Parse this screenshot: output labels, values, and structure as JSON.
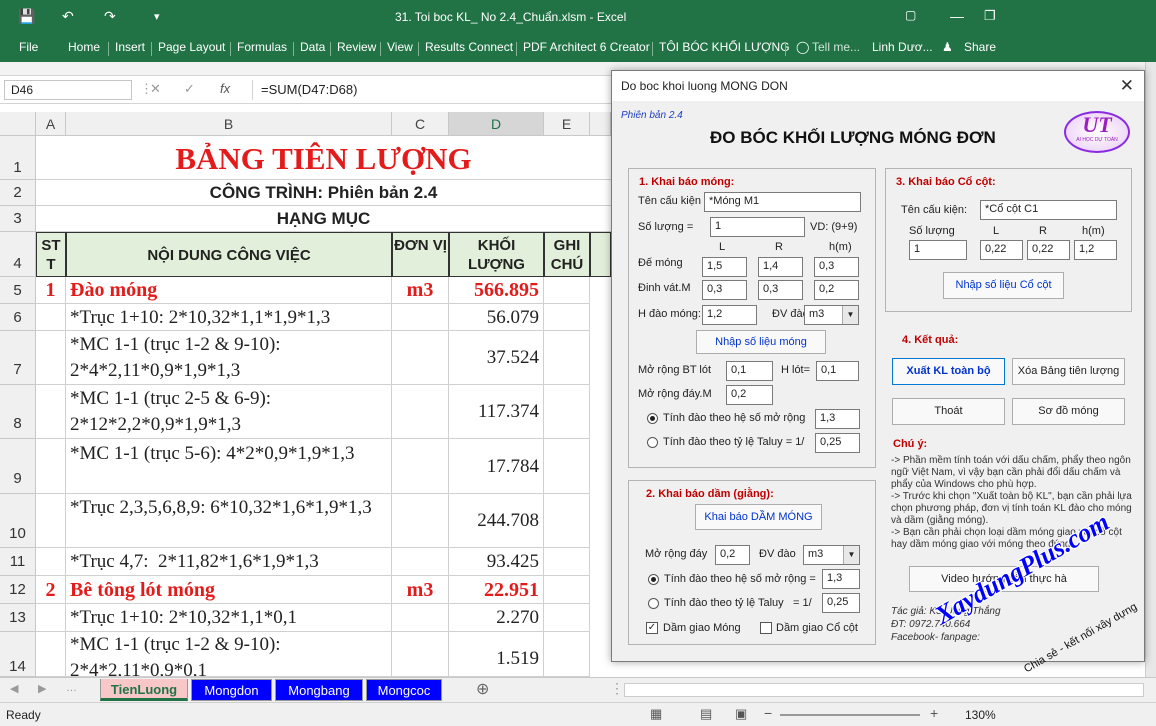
{
  "window": {
    "title": "31. Toi boc KL_ No 2.4_Chuẩn.xlsm - Excel",
    "user": "Linh Dươ...",
    "share": "Share",
    "tell_me": "Tell me..."
  },
  "menu": {
    "file": "File",
    "tabs": [
      "Home",
      "Insert",
      "Page Layout",
      "Formulas",
      "Data",
      "Review",
      "View",
      "Results Connect",
      "PDF Architect 6 Creator",
      "TÔI BÓC KHỐI LƯỢNG"
    ]
  },
  "formula_bar": {
    "name_box": "D46",
    "formula": "=SUM(D47:D68)"
  },
  "columns": [
    "A",
    "B",
    "C",
    "D",
    "E"
  ],
  "sheet": {
    "title": "BẢNG TIÊN LƯỢNG",
    "project": "CÔNG TRÌNH: Phiên bản 2.4",
    "category": "HẠNG MỤC",
    "headers": {
      "stt": "ST T",
      "content": "NỘI DUNG CÔNG VIỆC",
      "unit": "ĐƠN VỊ",
      "qty": "KHỐI LƯỢNG",
      "note": "GHI CHÚ"
    },
    "rows": [
      {
        "num": "5",
        "stt": "1",
        "content": "Đào móng",
        "unit": "m3",
        "qty": "566.895",
        "bold": true
      },
      {
        "num": "6",
        "stt": "",
        "content": "*Trục 1+10:  2*10,32*1,1*1,9*1,3",
        "unit": "",
        "qty": "56.079"
      },
      {
        "num": "7",
        "stt": "",
        "content": "*MC 1-1 (trục 1-2 & 9-10): 2*4*2,11*0,9*1,9*1,3",
        "unit": "",
        "qty": "37.524"
      },
      {
        "num": "8",
        "stt": "",
        "content": "*MC 1-1 (trục 2-5 & 6-9): 2*12*2,2*0,9*1,9*1,3",
        "unit": "",
        "qty": "117.374"
      },
      {
        "num": "9",
        "stt": "",
        "content": "*MC 1-1 (trục 5-6): 4*2*0,9*1,9*1,3",
        "unit": "",
        "qty": "17.784"
      },
      {
        "num": "10",
        "stt": "",
        "content": "*Trục 2,3,5,6,8,9: 6*10,32*1,6*1,9*1,3",
        "unit": "",
        "qty": "244.708"
      },
      {
        "num": "11",
        "stt": "",
        "content": "*Trục 4,7:  2*11,82*1,6*1,9*1,3",
        "unit": "",
        "qty": "93.425"
      },
      {
        "num": "12",
        "stt": "2",
        "content": "Bê tông lót móng",
        "unit": "m3",
        "qty": "22.951",
        "bold": true
      },
      {
        "num": "13",
        "stt": "",
        "content": "*Trục 1+10: 2*10,32*1,1*0,1",
        "unit": "",
        "qty": "2.270"
      },
      {
        "num": "14",
        "stt": "",
        "content": "*MC 1-1 (trục 1-2 & 9-10): 2*4*2,11*0,9*0,1",
        "unit": "",
        "qty": "1.519"
      }
    ]
  },
  "sheet_tabs": [
    "TienLuong",
    "Mongdon",
    "Mongbang",
    "Mongcoc"
  ],
  "status": {
    "ready": "Ready",
    "zoom": "130%"
  },
  "dialog": {
    "title": "Do boc khoi luong MONG DON",
    "version": "Phiên bản 2.4",
    "heading": "ĐO BÓC KHỐI LƯỢNG MÓNG ĐƠN",
    "logo": "UT",
    "logo_sub": "AI HỌC DỰ TOÁN",
    "s1": {
      "label": "1. Khai báo móng:",
      "name_label": "Tên cấu kiện",
      "name_value": "*Móng M1",
      "qty_label": "Số lượng =",
      "qty_value": "1",
      "vd": "VD:  (9+9)",
      "col_l": "L",
      "col_r": "R",
      "col_h": "h(m)",
      "de_mong": "Đế móng",
      "de_l": "1,5",
      "de_r": "1,4",
      "de_h": "0,3",
      "dinh_vat": "Đinh vát.M",
      "dv_l": "0,3",
      "dv_r": "0,3",
      "dv_h": "0,2",
      "h_dao_label": "H đào móng:",
      "h_dao": "1,2",
      "dv_dao_label": "ĐV đào",
      "dv_dao": "m3",
      "nhap_btn": "Nhập số liệu móng",
      "mo_rong_bt": "Mở rộng BT lót",
      "mo_rong_bt_val": "0,1",
      "h_lot_label": "H lót=",
      "h_lot": "0,1",
      "mo_rong_day": "Mở rộng đáy.M",
      "mo_rong_day_val": "0,2",
      "r1": "Tính đào theo hệ số mở rộng",
      "r1_val": "1,3",
      "r2": "Tính đào theo tỷ lệ Taluy = 1/",
      "r2_val": "0,25"
    },
    "s2": {
      "label": "2. Khai báo dầm (giằng):",
      "btn": "Khai báo DẦM MÓNG",
      "mo_rong": "Mở rộng đáy",
      "mo_rong_val": "0,2",
      "dv_dao_label": "ĐV đào",
      "dv_dao": "m3",
      "r1": "Tính đào theo hệ số mở rộng =",
      "r1_val": "1,3",
      "r2": "Tính đào theo tỷ lệ Taluy",
      "r2_eq": "= 1/",
      "r2_val": "0,25",
      "c1": "Dầm giao Móng",
      "c2": "Dầm giao Cổ cột"
    },
    "s3": {
      "label": "3. Khai báo Cổ cột:",
      "name_label": "Tên cấu kiện:",
      "name_value": "*Cổ cột C1",
      "qty_label": "Số lượng",
      "col_l": "L",
      "col_r": "R",
      "col_h": "h(m)",
      "qty": "1",
      "l": "0,22",
      "r": "0,22",
      "h": "1,2",
      "btn": "Nhập số liệu Cổ cột"
    },
    "s4": {
      "label": "4. Kết quả:",
      "b1": "Xuất KL toàn bộ",
      "b2": "Xóa Bảng tiên lượng",
      "b3": "Thoát",
      "b4": "Sơ đồ móng"
    },
    "notes": {
      "label": "Chú ý:",
      "n1": "-> Phần mềm tính toán với dấu chấm, phẩy theo ngôn ngữ Việt Nam, vì vậy bạn cần phải đổi dấu chấm và phẩy của Windows cho phù hợp.",
      "n2": "-> Trước khi chọn \"Xuất toàn bộ KL\", bạn cần phải lựa chọn phương pháp, đơn vị tính toán KL đào cho móng và dầm (giằng móng).",
      "n3": "-> Bạn cần phải chọn loại dầm móng giao với cổ cột hay dầm móng giao với móng theo đúng"
    },
    "video_btn": "Video hướng dẫn thực hà",
    "author": {
      "l1": "Tác giả:  KS.Uông Thắng",
      "l2": "ĐT:        0972.740.664",
      "l3": "Facebook- fanpage:"
    }
  },
  "watermark": {
    "main": "XaydungPlus.com",
    "sub": "Chia sẻ - kết nối xây dựng"
  }
}
